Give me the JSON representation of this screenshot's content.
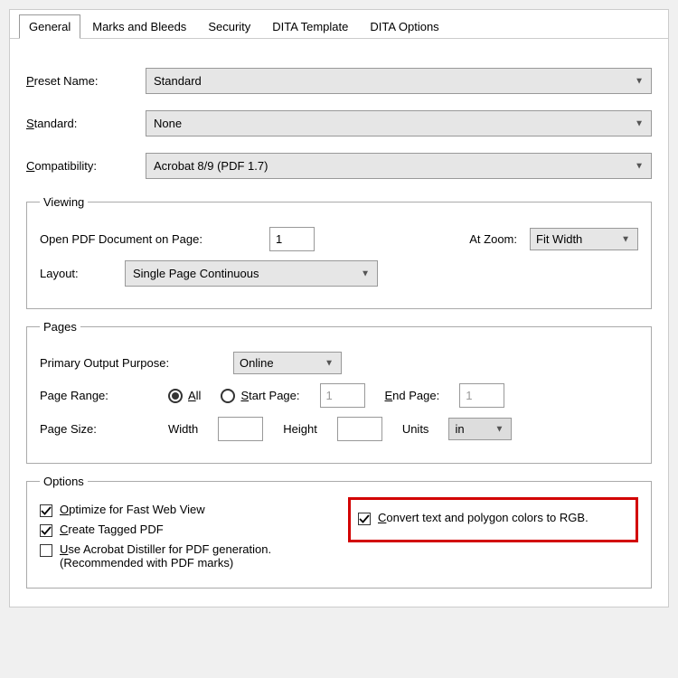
{
  "tabs": [
    "General",
    "Marks and Bleeds",
    "Security",
    "DITA Template",
    "DITA Options"
  ],
  "activeTab": 0,
  "general": {
    "presetName": {
      "label": "Preset Name:",
      "accel": "P",
      "value": "Standard"
    },
    "standard": {
      "label": "Standard:",
      "accel": "S",
      "value": "None"
    },
    "compatibility": {
      "label": "Compatibility:",
      "accel": "C",
      "value": "Acrobat 8/9 (PDF 1.7)"
    }
  },
  "viewing": {
    "legend": "Viewing",
    "openPage": {
      "label": "Open PDF Document on Page:",
      "value": "1"
    },
    "atZoom": {
      "label": "At Zoom:",
      "value": "Fit Width"
    },
    "layout": {
      "label": "Layout:",
      "value": "Single Page Continuous"
    }
  },
  "pages": {
    "legend": "Pages",
    "primaryPurpose": {
      "label": "Primary Output Purpose:",
      "value": "Online"
    },
    "pageRange": {
      "label": "Page Range:",
      "all": {
        "label": "All",
        "accel": "A",
        "checked": true
      },
      "startPage": {
        "label": "Start Page:",
        "accel": "S",
        "value": "1",
        "checked": false
      },
      "endPage": {
        "label": "End Page:",
        "accel": "E",
        "value": "1"
      }
    },
    "pageSize": {
      "label": "Page Size:",
      "width": {
        "label": "Width",
        "value": ""
      },
      "height": {
        "label": "Height",
        "value": ""
      },
      "units": {
        "label": "Units",
        "value": "in"
      }
    }
  },
  "options": {
    "legend": "Options",
    "optFastWeb": {
      "label": "Optimize for Fast Web View",
      "accel": "O",
      "checked": true
    },
    "createTagged": {
      "label": "Create Tagged PDF",
      "accel": "C",
      "checked": true
    },
    "useDistiller": {
      "label": "Use Acrobat Distiller for PDF generation.",
      "sub": "(Recommended with PDF marks)",
      "accel": "U",
      "checked": false
    },
    "convertRGB": {
      "label": "Convert text and polygon colors to RGB.",
      "accel": "C",
      "checked": true
    }
  }
}
